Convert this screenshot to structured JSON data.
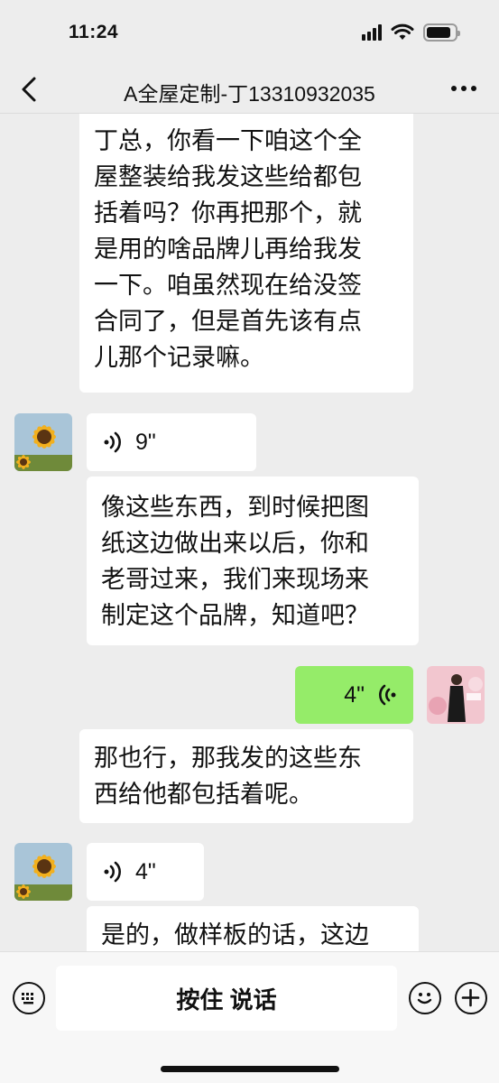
{
  "status_bar": {
    "time": "11:24"
  },
  "nav": {
    "title": "A全屋定制-丁13310932035"
  },
  "messages": {
    "m1": [
      "丁总，你看一下咱这个全",
      "屋整装给我发这些给都包",
      "括着吗？你再把那个，就",
      "是用的啥品牌儿再给我发",
      "一下。咱虽然现在给没签",
      "合同了，但是首先该有点",
      "儿那个记录嘛。"
    ],
    "m2_voice": "9\"",
    "m3": [
      "像这些东西，到时候把图",
      "纸这边做出来以后，你和",
      "老哥过来，我们来现场来",
      "制定这个品牌，知道吧？"
    ],
    "m4_voice": "4\"",
    "m5": [
      "那也行，那我发的这些东",
      "西给他都包括着呢。"
    ],
    "m6_voice": "4\"",
    "m7": [
      "是的，做样板的话，这边"
    ]
  },
  "input_bar": {
    "hold_to_talk": "按住 说话"
  }
}
